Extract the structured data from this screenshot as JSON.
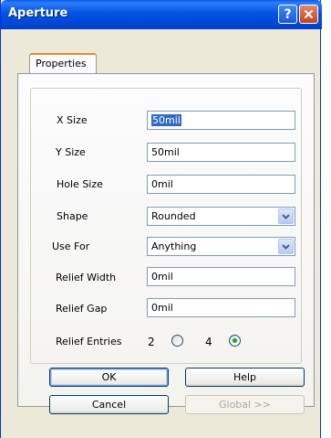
{
  "window": {
    "title": "Aperture",
    "help_glyph": "?"
  },
  "tabs": [
    {
      "label": "Properties",
      "active": true
    }
  ],
  "fields": {
    "x_size": {
      "label": "X Size",
      "value": "50mil"
    },
    "y_size": {
      "label": "Y Size",
      "value": "50mil"
    },
    "hole_size": {
      "label": "Hole Size",
      "value": "0mil"
    },
    "shape": {
      "label": "Shape",
      "value": "Rounded"
    },
    "use_for": {
      "label": "Use For",
      "value": "Anything"
    },
    "relief_width": {
      "label": "Relief Width",
      "value": "0mil"
    },
    "relief_gap": {
      "label": "Relief Gap",
      "value": "0mil"
    }
  },
  "relief_entries": {
    "label": "Relief Entries",
    "options": [
      {
        "label": "2",
        "selected": false
      },
      {
        "label": "4",
        "selected": true
      }
    ]
  },
  "buttons": {
    "ok": "OK",
    "help": "Help",
    "cancel": "Cancel",
    "global": "Global >>"
  },
  "colors": {
    "titlebar": "#0054e3",
    "dialog_bg": "#ece9d8",
    "tab_accent": "#e68b2c",
    "selection": "#316ac5"
  }
}
